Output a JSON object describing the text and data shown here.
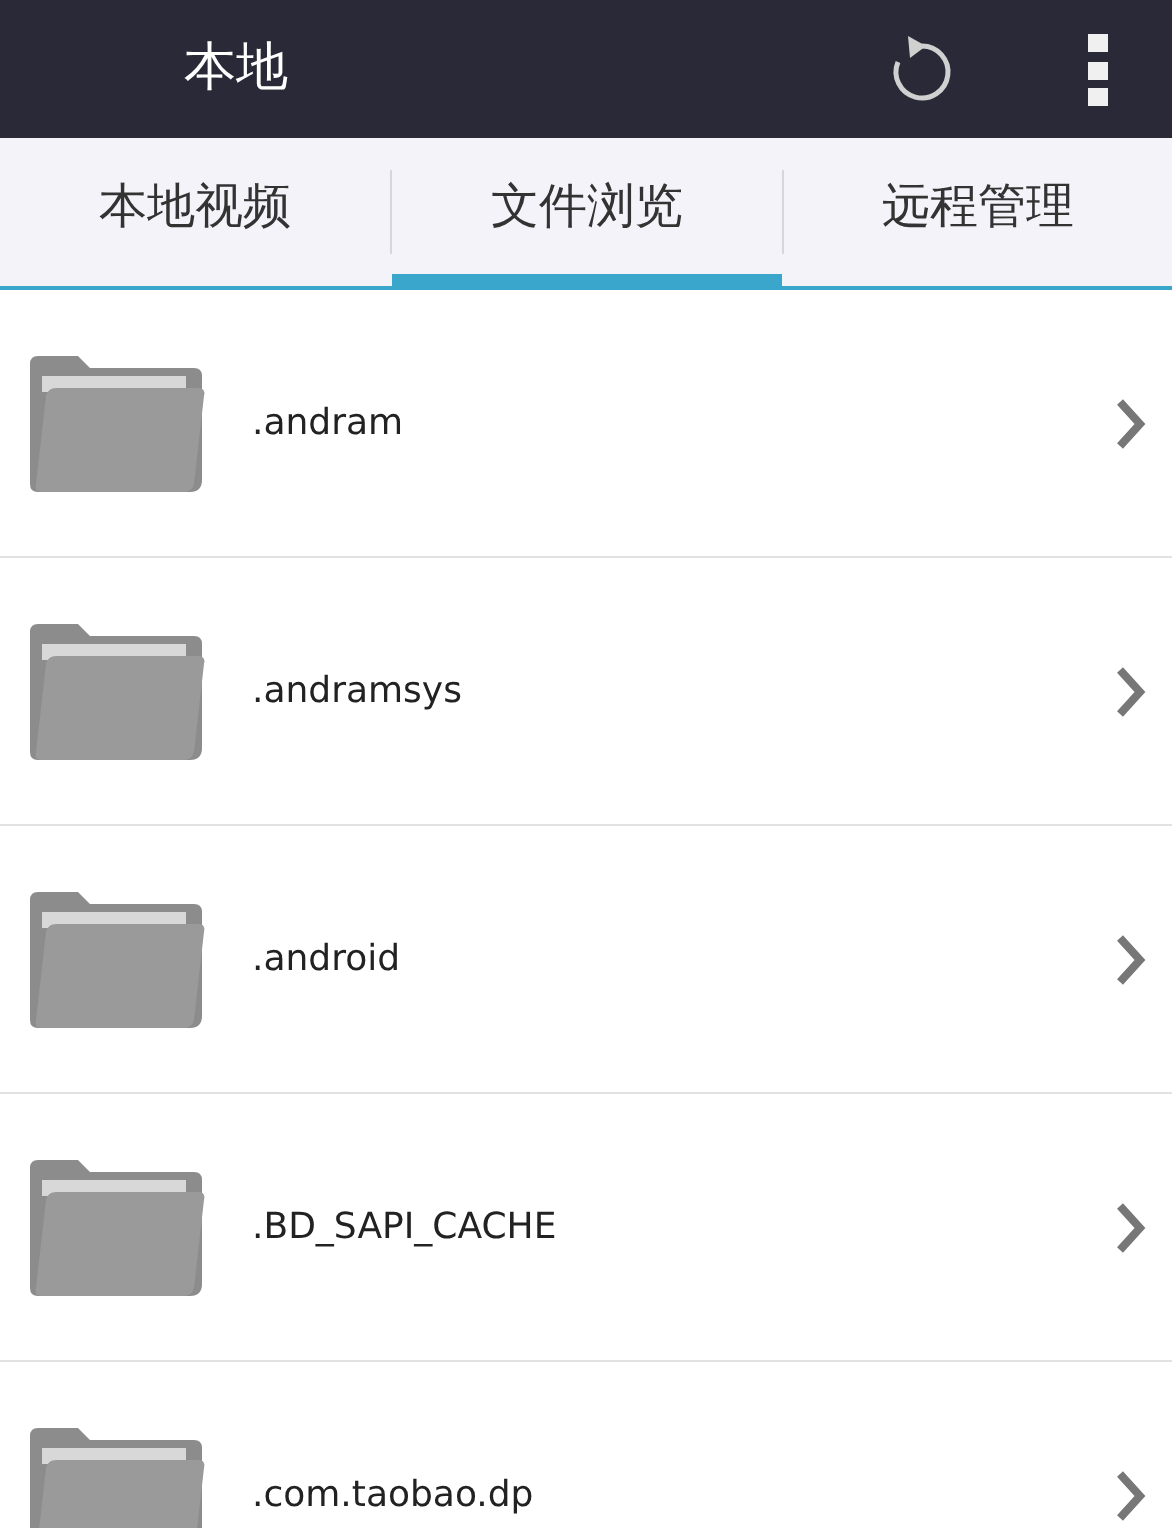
{
  "header": {
    "title": "本地"
  },
  "tabs": [
    {
      "label": "本地视频",
      "selected": false
    },
    {
      "label": "文件浏览",
      "selected": true
    },
    {
      "label": "远程管理",
      "selected": false
    }
  ],
  "files": [
    {
      "name": ".andram"
    },
    {
      "name": ".andramsys"
    },
    {
      "name": ".android"
    },
    {
      "name": ".BD_SAPI_CACHE"
    },
    {
      "name": ".com.taobao.dp"
    }
  ]
}
